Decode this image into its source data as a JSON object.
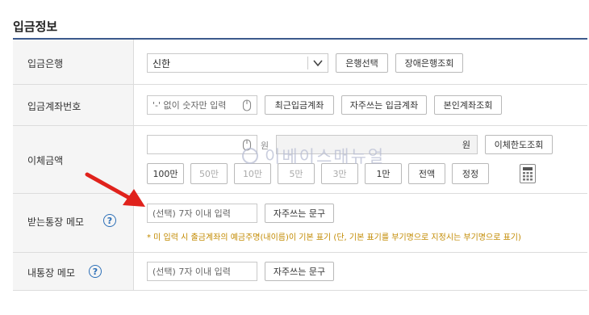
{
  "section": {
    "title": "입금정보"
  },
  "bank_row": {
    "label": "입금은행",
    "bank_value": "신한",
    "select_button": "은행선택",
    "outage_button": "장애은행조회"
  },
  "account_row": {
    "label": "입금계좌번호",
    "placeholder": "'-' 없이 숫자만 입력",
    "recent_button": "최근입금계좌",
    "frequent_button": "자주쓰는 입금계좌",
    "own_button": "본인계좌조회"
  },
  "amount_row": {
    "label": "이체금액",
    "unit1": "원",
    "unit2": "원",
    "limit_button": "이체한도조회",
    "quick_amounts": [
      "100만",
      "50만",
      "10만",
      "5만",
      "3만",
      "1만",
      "전액",
      "정정"
    ]
  },
  "recv_memo_row": {
    "label": "받는통장 메모",
    "help": "?",
    "placeholder": "(선택) 7자 이내 입력",
    "phrase_button": "자주쓰는 문구",
    "note": "* 미 입력 시 출금계좌의 예금주명(내이름)이 기본 표기 (단, 기본 표기를 부기명으로 지정시는 부기명으로 표기)"
  },
  "my_memo_row": {
    "label": "내통장 메모",
    "help": "?",
    "placeholder": "(선택) 7자 이내 입력",
    "phrase_button": "자주쓰는 문구"
  },
  "watermark": {
    "text": "이베이스매뉴얼"
  },
  "colors": {
    "accent": "#3c5a8c",
    "note": "#c28a00",
    "arrow": "#e0221c",
    "help": "#2c6fb7"
  },
  "icons": [
    "chevron-down-icon",
    "mouse-icon",
    "calculator-icon",
    "help-icon",
    "arrow-annotation"
  ]
}
